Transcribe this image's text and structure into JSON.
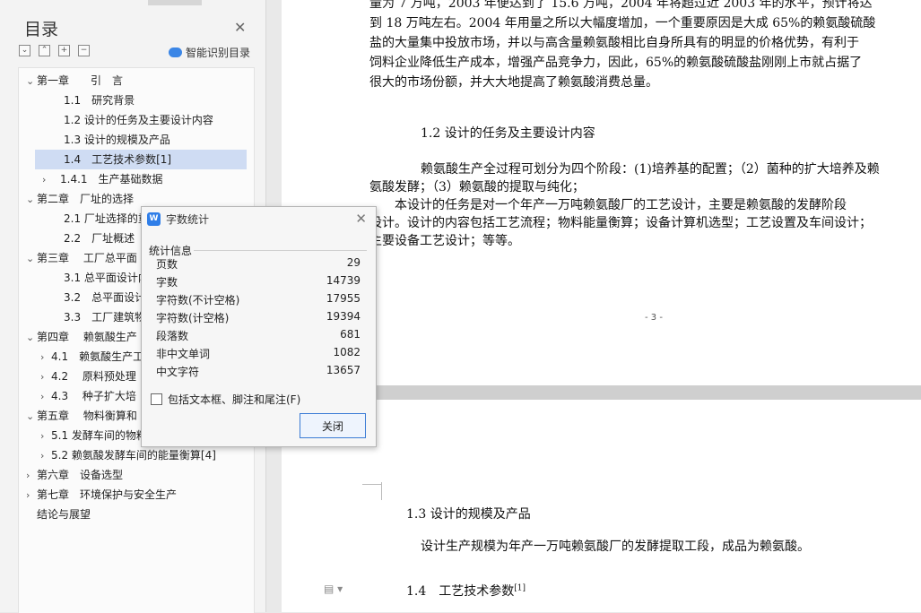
{
  "nav": {
    "title": "目录",
    "smart_label": "智能识别目录",
    "toc": [
      {
        "text": "第一章　　引　言",
        "level": 0,
        "chevron": "⌄"
      },
      {
        "text": "1.1　研究背景",
        "level": 1,
        "chevron": ""
      },
      {
        "text": "1.2  设计的任务及主要设计内容",
        "level": 1,
        "chevron": ""
      },
      {
        "text": "1.3  设计的规模及产品",
        "level": 1,
        "chevron": ""
      },
      {
        "text": "1.4　工艺技术参数[1]",
        "level": 1,
        "chevron": "",
        "selected": true
      },
      {
        "text": "1.4.1　生产基础数据",
        "level": 1,
        "chevron": "›"
      },
      {
        "text": "第二章　厂址的选择",
        "level": 0,
        "chevron": "⌄"
      },
      {
        "text": "2.1  厂址选择的重",
        "level": 1,
        "chevron": ""
      },
      {
        "text": "2.2　厂址概述",
        "level": 1,
        "chevron": ""
      },
      {
        "text": "第三章　  工厂总平面",
        "level": 0,
        "chevron": "⌄"
      },
      {
        "text": "3.1 总平面设计内容",
        "level": 1,
        "chevron": ""
      },
      {
        "text": "3.2　总平面设计的",
        "level": 1,
        "chevron": ""
      },
      {
        "text": "3.3　工厂建筑物面",
        "level": 1,
        "chevron": ""
      },
      {
        "text": "第四章　 赖氨酸生产",
        "level": 0,
        "chevron": "⌄"
      },
      {
        "text": "4.1　赖氨酸生产工",
        "level": 0.5,
        "chevron": "›"
      },
      {
        "text": "4.2　  原料预处理",
        "level": 0.5,
        "chevron": "›"
      },
      {
        "text": "4.3　 种子扩大培",
        "level": 0.5,
        "chevron": "›"
      },
      {
        "text": "第五章　 物料衡算和",
        "level": 0,
        "chevron": "⌄"
      },
      {
        "text": "5.1 发酵车间的物料",
        "level": 0.5,
        "chevron": "›"
      },
      {
        "text": "5.2  赖氨酸发酵车间的能量衡算[4]",
        "level": 0.5,
        "chevron": "›"
      },
      {
        "text": "第六章　设备选型",
        "level": 0,
        "chevron": "›"
      },
      {
        "text": "第七章　环境保护与安全生产",
        "level": 0,
        "chevron": "›"
      },
      {
        "text": "结论与展望",
        "level": 0,
        "chevron": ""
      }
    ]
  },
  "page3": {
    "para1": [
      "量为 7 万吨，2003 年便达到了 15.6 万吨，2004 年将超过近 2003 年的水平，预计将达",
      "到 18 万吨左右。2004 年用量之所以大幅度增加，一个重要原因是大成 65%的赖氨酸硫酸",
      "盐的大量集中投放市场，并以与高含量赖氨酸相比自身所具有的明显的价格优势，有利于",
      "饲料企业降低生产成本，增强产品竞争力，因此，65%的赖氨酸硫酸盐刚刚上市就占据了",
      "很大的市场份额，并大大地提高了赖氨酸消费总量。"
    ],
    "heading": "1.2  设计的任务及主要设计内容",
    "para2": [
      "赖氨酸生产全过程可划分为四个阶段：(1)培养基的配置；（2）菌种的扩大培养及赖",
      "氨酸发酵；（3）赖氨酸的提取与纯化；",
      "本设计的任务是对一个年产一万吨赖氨酸厂的工艺设计，主要是赖氨酸的发酵阶段",
      "设计。设计的内容包括工艺流程；物料能量衡算；设备计算机选型；工艺设置及车间设计；",
      "主要设备工艺设计；等等。"
    ],
    "page_number": "- 3 -"
  },
  "page4": {
    "heading1": "1.3  设计的规模及产品",
    "para": "设计生产规模为年产一万吨赖氨酸厂的发酵提取工段，成品为赖氨酸。",
    "heading2": "1.4　工艺技术参数",
    "heading2_sup": "[1]"
  },
  "dialog": {
    "title": "字数统计",
    "group_label": "统计信息",
    "stats": [
      {
        "label": "页数",
        "value": "29"
      },
      {
        "label": "字数",
        "value": "14739"
      },
      {
        "label": "字符数(不计空格)",
        "value": "17955"
      },
      {
        "label": "字符数(计空格)",
        "value": "19394"
      },
      {
        "label": "段落数",
        "value": "681"
      },
      {
        "label": "非中文单词",
        "value": "1082"
      },
      {
        "label": "中文字符",
        "value": "13657"
      }
    ],
    "checkbox_label": "包括文本框、脚注和尾注(F)",
    "close_label": "关闭"
  }
}
